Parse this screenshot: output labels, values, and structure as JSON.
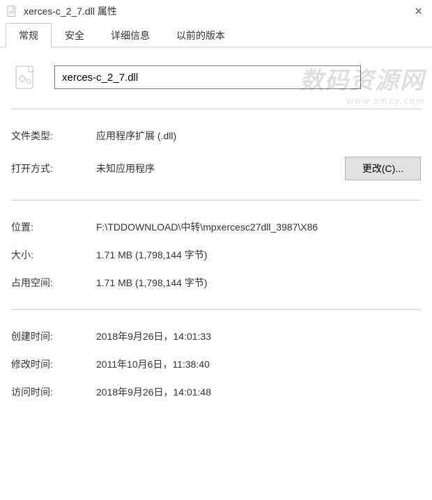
{
  "window": {
    "title": "xerces-c_2_7.dll 属性"
  },
  "tabs": {
    "general": "常规",
    "security": "安全",
    "details": "详细信息",
    "previous": "以前的版本"
  },
  "file": {
    "name": "xerces-c_2_7.dll"
  },
  "labels": {
    "file_type": "文件类型:",
    "opens_with": "打开方式:",
    "location": "位置:",
    "size": "大小:",
    "size_on_disk": "占用空间:",
    "created": "创建时间:",
    "modified": "修改时间:",
    "accessed": "访问时间:",
    "change_btn": "更改(C)..."
  },
  "values": {
    "file_type": "应用程序扩展 (.dll)",
    "opens_with": "未知应用程序",
    "location": "F:\\TDDOWNLOAD\\中转\\mpxercesc27dll_3987\\X86",
    "size": "1.71 MB (1,798,144 字节)",
    "size_on_disk": "1.71 MB (1,798,144 字节)",
    "created": "2018年9月26日，14:01:33",
    "modified": "2011年10月6日，11:38:40",
    "accessed": "2018年9月26日，14:01:48"
  },
  "watermark": {
    "main": "数码资源网",
    "sub": "www.smzy.com"
  }
}
